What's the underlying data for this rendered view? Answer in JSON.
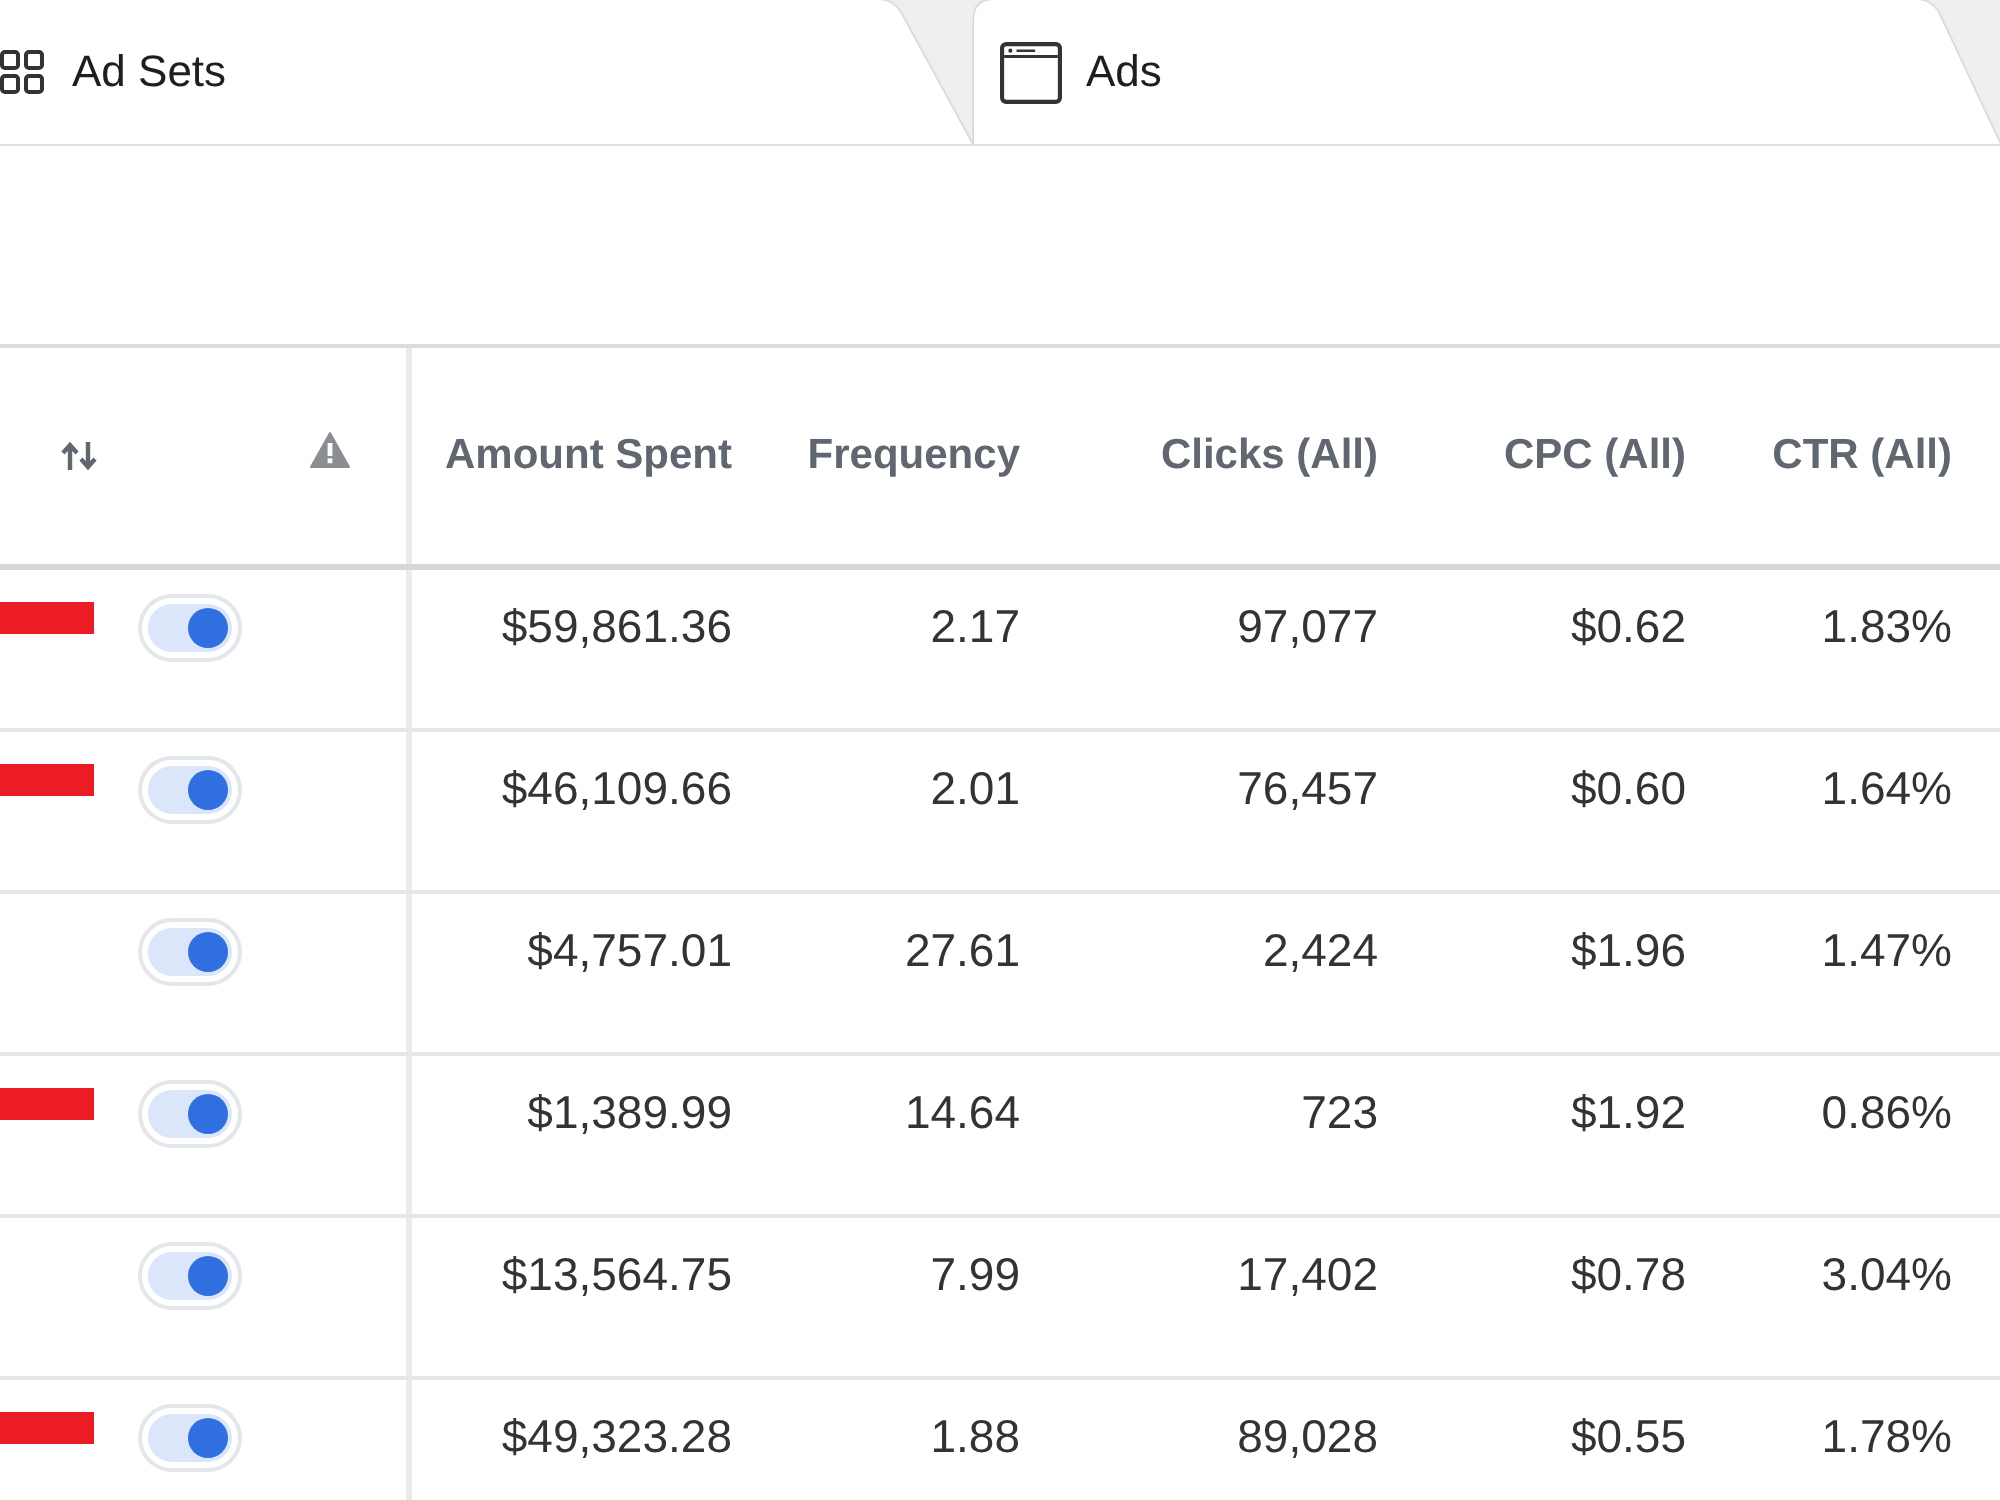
{
  "tabs": [
    {
      "label": "Ad Sets"
    },
    {
      "label": "Ads"
    }
  ],
  "table": {
    "columns": [
      "Amount Spent",
      "Frequency",
      "Clicks (All)",
      "CPC (All)",
      "CTR (All)"
    ],
    "rows": [
      {
        "redacted": true,
        "on": true,
        "cells": [
          "$59,861.36",
          "2.17",
          "97,077",
          "$0.62",
          "1.83%"
        ]
      },
      {
        "redacted": true,
        "on": true,
        "cells": [
          "$46,109.66",
          "2.01",
          "76,457",
          "$0.60",
          "1.64%"
        ]
      },
      {
        "redacted": false,
        "on": true,
        "cells": [
          "$4,757.01",
          "27.61",
          "2,424",
          "$1.96",
          "1.47%"
        ]
      },
      {
        "redacted": true,
        "on": true,
        "cells": [
          "$1,389.99",
          "14.64",
          "723",
          "$1.92",
          "0.86%"
        ]
      },
      {
        "redacted": false,
        "on": true,
        "cells": [
          "$13,564.75",
          "7.99",
          "17,402",
          "$0.78",
          "3.04%"
        ]
      },
      {
        "redacted": true,
        "on": true,
        "cells": [
          "$49,323.28",
          "1.88",
          "89,028",
          "$0.55",
          "1.78%"
        ]
      }
    ]
  }
}
